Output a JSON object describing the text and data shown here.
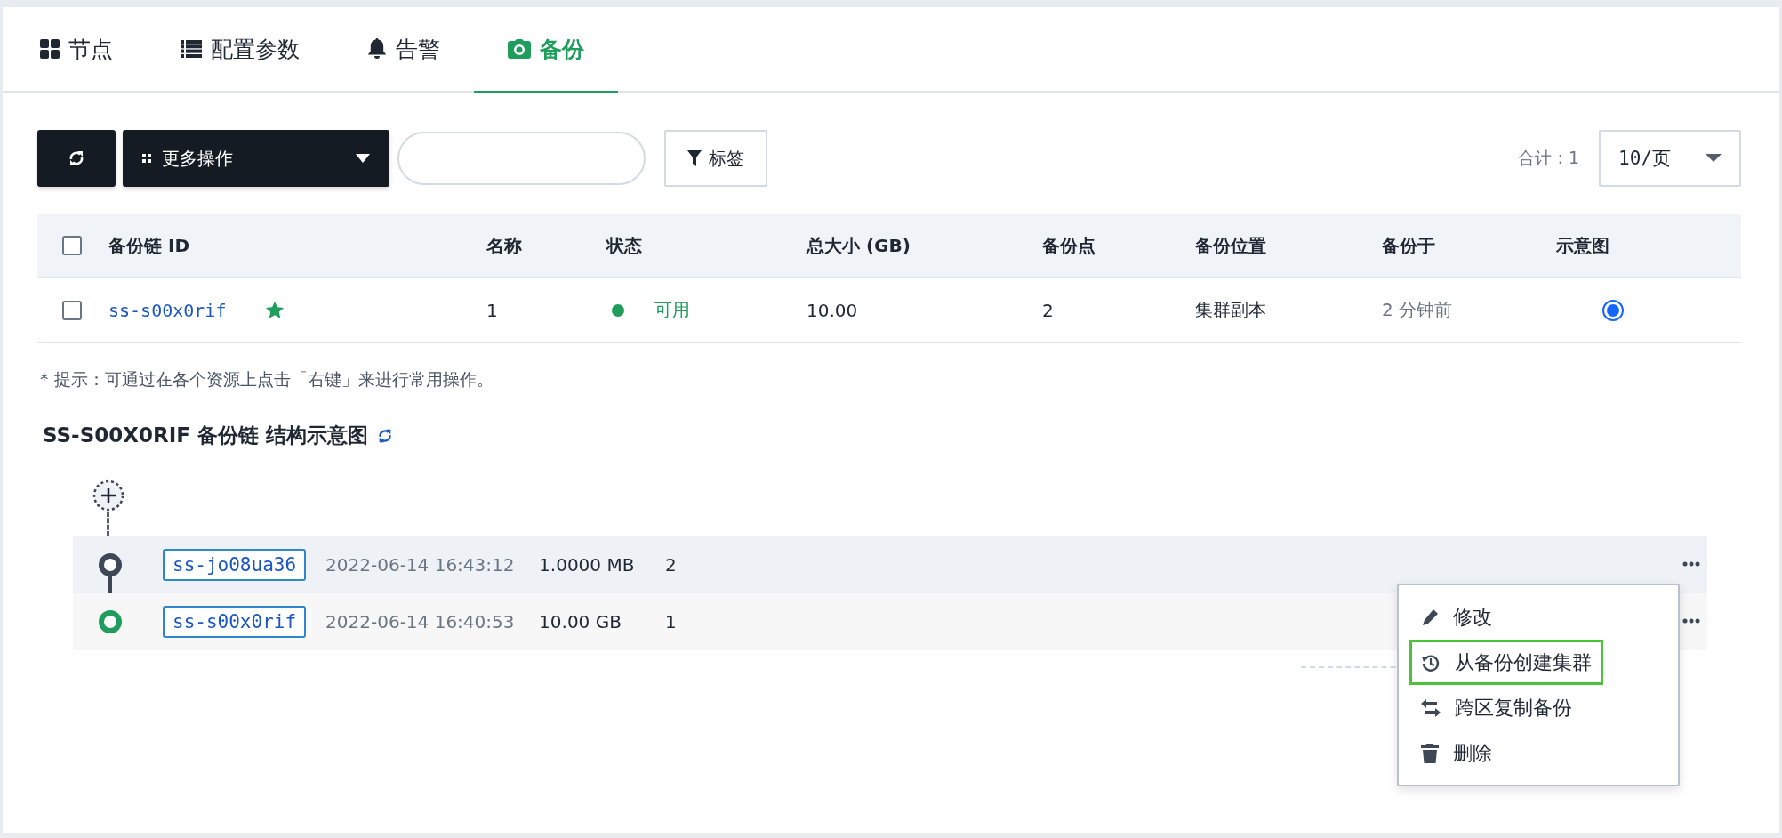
{
  "tabs": [
    {
      "label": "节点",
      "kind": "grid",
      "selected": false
    },
    {
      "label": "配置参数",
      "kind": "list",
      "selected": false
    },
    {
      "label": "告警",
      "kind": "bell",
      "selected": false
    },
    {
      "label": "备份",
      "kind": "camera",
      "selected": true
    }
  ],
  "toolbar": {
    "more_actions": "更多操作",
    "filter": "标签",
    "total": "合计 : 1",
    "page_size": "10/页"
  },
  "table": {
    "columns": [
      "备份链 ID",
      "名称",
      "状态",
      "总大小 (GB)",
      "备份点",
      "备份位置",
      "备份于",
      "示意图"
    ],
    "rows": [
      {
        "checked": false,
        "id": "ss-s00x0rif",
        "starred": true,
        "name": "1",
        "status": {
          "text": "可用",
          "color": "#1f9d5c"
        },
        "size": "10.00",
        "points": "2",
        "location": "集群副本",
        "time": "2 分钟前",
        "diagram_selected": true
      }
    ],
    "select_all_checked": false
  },
  "hint": "* 提示：可通过在各个资源上点击「右键」来进行常用操作。",
  "diagram": {
    "title": "SS-S00X0RIF 备份链 结构示意图",
    "nodes": [
      {
        "id": "ss-jo08ua36",
        "time": "2022-06-14 16:43:12",
        "size": "1.0000 MB",
        "count": "2",
        "color": "#3e4756"
      },
      {
        "id": "ss-s00x0rif",
        "time": "2022-06-14 16:40:53",
        "size": "10.00 GB",
        "count": "1",
        "color": "#1f9d5c"
      }
    ]
  },
  "context_menu": [
    {
      "label": "修改",
      "kind": "edit",
      "selected": false
    },
    {
      "label": "从备份创建集群",
      "kind": "restore",
      "selected": true
    },
    {
      "label": "跨区复制备份",
      "kind": "copy",
      "selected": false
    },
    {
      "label": "删除",
      "kind": "delete",
      "selected": false
    }
  ]
}
